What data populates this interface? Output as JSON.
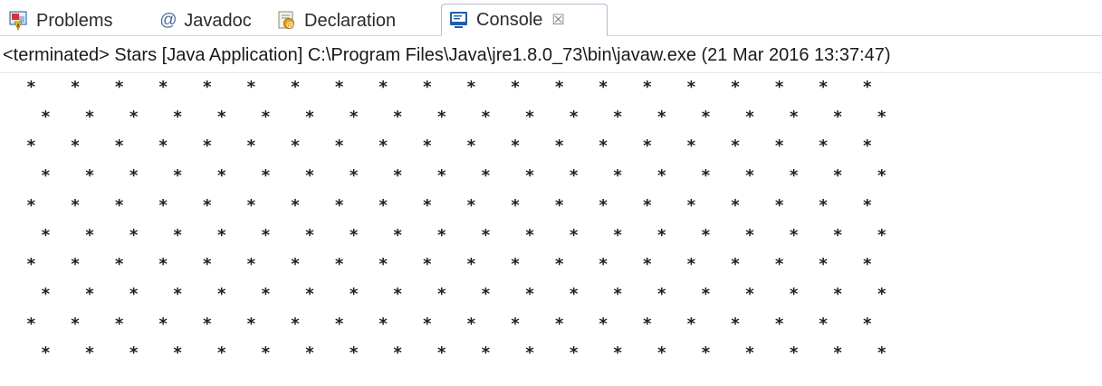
{
  "tabs": [
    {
      "label": "Problems",
      "icon": "problems-icon"
    },
    {
      "label": "Javadoc",
      "icon": "javadoc-at-icon",
      "glyph": "@"
    },
    {
      "label": "Declaration",
      "icon": "declaration-icon"
    },
    {
      "label": "Console",
      "icon": "console-icon",
      "active": true,
      "close_glyph": "☒"
    }
  ],
  "status_line": "<terminated> Stars [Java Application] C:\\Program Files\\Java\\jre1.8.0_73\\bin\\javaw.exe (21 Mar 2016 13:37:47)",
  "console": {
    "star_char": "*",
    "rows": 10,
    "odd_row_stars": 20,
    "even_row_stars": 20
  },
  "colors": {
    "tab_border": "#aebbd0",
    "console_icon": "#1f5fa8",
    "problems_icon_red": "#d9342b",
    "problems_icon_blue": "#3a6fb7",
    "declaration_icon": "#e5a62b"
  }
}
